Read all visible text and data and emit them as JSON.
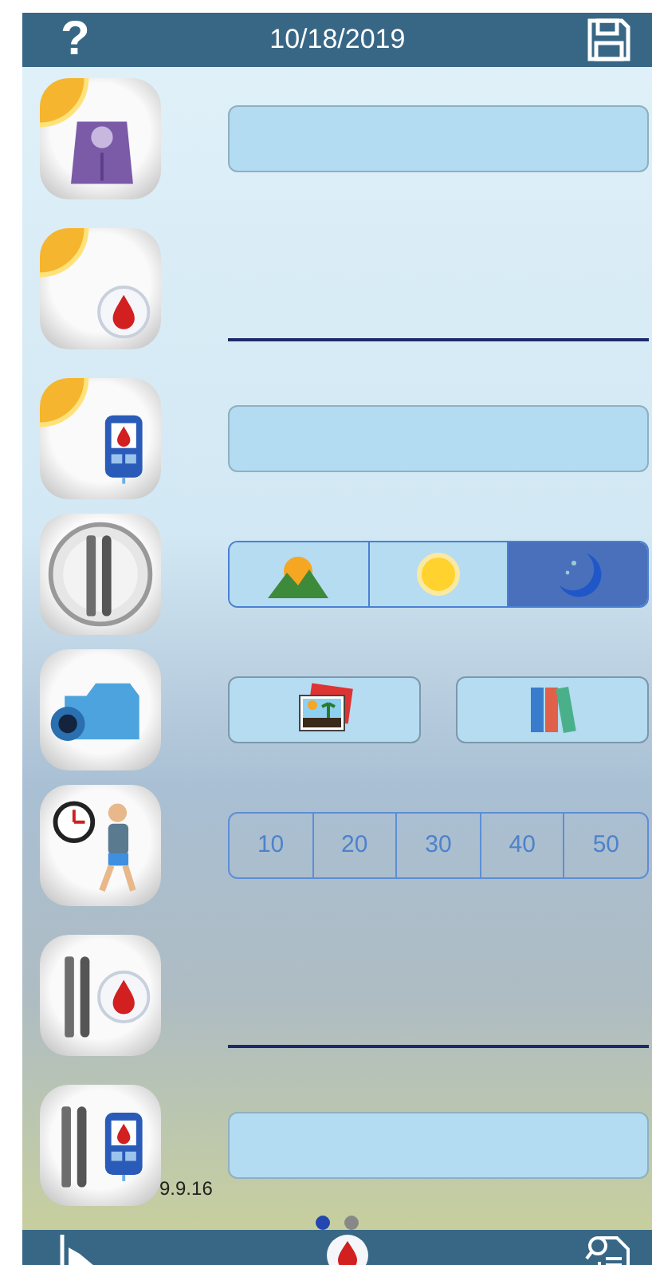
{
  "header": {
    "help": "?",
    "date": "10/18/2019"
  },
  "rows": [
    {
      "kind": "field"
    },
    {
      "kind": "line"
    },
    {
      "kind": "field"
    },
    {
      "kind": "segmented",
      "segments": [
        {
          "selected": false
        },
        {
          "selected": false
        },
        {
          "selected": true
        }
      ]
    },
    {
      "kind": "buttons"
    },
    {
      "kind": "numbers",
      "options": [
        "10",
        "20",
        "30",
        "40",
        "50"
      ]
    },
    {
      "kind": "line"
    },
    {
      "kind": "field"
    }
  ],
  "version": "9.9.16",
  "pages": [
    {
      "selected": true
    },
    {
      "selected": false
    }
  ]
}
